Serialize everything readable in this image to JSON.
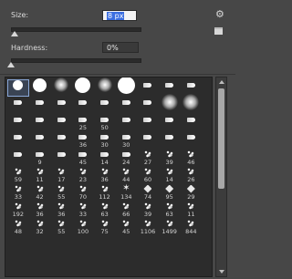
{
  "size": {
    "label": "Size:",
    "value": "8 px",
    "level": 0.03
  },
  "hardness": {
    "label": "Hardness:",
    "value": "0%",
    "level": 0.0
  },
  "icons": {
    "settings": "gear-icon",
    "new_preset": "new-preset-icon"
  },
  "brushes": [
    {
      "kind": "hard",
      "label": ""
    },
    {
      "kind": "hard",
      "label": ""
    },
    {
      "kind": "soft",
      "label": ""
    },
    {
      "kind": "hard",
      "label": ""
    },
    {
      "kind": "soft",
      "label": ""
    },
    {
      "kind": "hard",
      "label": ""
    },
    {
      "kind": "tip",
      "label": ""
    },
    {
      "kind": "tip",
      "label": ""
    },
    {
      "kind": "tip",
      "label": ""
    },
    {
      "kind": "tip",
      "label": ""
    },
    {
      "kind": "tip",
      "label": ""
    },
    {
      "kind": "tip",
      "label": ""
    },
    {
      "kind": "tip",
      "label": ""
    },
    {
      "kind": "tip",
      "label": ""
    },
    {
      "kind": "tip",
      "label": ""
    },
    {
      "kind": "tip",
      "label": ""
    },
    {
      "kind": "soft",
      "label": ""
    },
    {
      "kind": "soft",
      "label": ""
    },
    {
      "kind": "tip",
      "label": ""
    },
    {
      "kind": "tip",
      "label": ""
    },
    {
      "kind": "tip",
      "label": ""
    },
    {
      "kind": "tip",
      "label": "25"
    },
    {
      "kind": "tip",
      "label": "50"
    },
    {
      "kind": "tip",
      "label": ""
    },
    {
      "kind": "tip",
      "label": ""
    },
    {
      "kind": "tip",
      "label": ""
    },
    {
      "kind": "tip",
      "label": ""
    },
    {
      "kind": "tip",
      "label": ""
    },
    {
      "kind": "tip",
      "label": ""
    },
    {
      "kind": "tip",
      "label": ""
    },
    {
      "kind": "tip",
      "label": "36"
    },
    {
      "kind": "tip",
      "label": "30"
    },
    {
      "kind": "tip",
      "label": "30"
    },
    {
      "kind": "tip",
      "label": ""
    },
    {
      "kind": "tip",
      "label": ""
    },
    {
      "kind": "tip",
      "label": ""
    },
    {
      "kind": "tip",
      "label": ""
    },
    {
      "kind": "tip",
      "label": "9"
    },
    {
      "kind": "tip",
      "label": ""
    },
    {
      "kind": "tip",
      "label": "45"
    },
    {
      "kind": "tip",
      "label": "14"
    },
    {
      "kind": "tip",
      "label": "24"
    },
    {
      "kind": "splat",
      "label": "27"
    },
    {
      "kind": "splat",
      "label": "39"
    },
    {
      "kind": "splat",
      "label": "46"
    },
    {
      "kind": "splat",
      "label": "59"
    },
    {
      "kind": "splat",
      "label": "11"
    },
    {
      "kind": "splat",
      "label": "17"
    },
    {
      "kind": "splat",
      "label": "23"
    },
    {
      "kind": "splat",
      "label": "36"
    },
    {
      "kind": "splat",
      "label": "44"
    },
    {
      "kind": "splat",
      "label": "60"
    },
    {
      "kind": "splat",
      "label": "14"
    },
    {
      "kind": "splat",
      "label": "26"
    },
    {
      "kind": "splat",
      "label": "33"
    },
    {
      "kind": "splat",
      "label": "42"
    },
    {
      "kind": "splat",
      "label": "55"
    },
    {
      "kind": "splat",
      "label": "70"
    },
    {
      "kind": "splat",
      "label": "112"
    },
    {
      "kind": "star",
      "label": "134"
    },
    {
      "kind": "leaf",
      "label": "74"
    },
    {
      "kind": "leaf",
      "label": "95"
    },
    {
      "kind": "leaf",
      "label": "29"
    },
    {
      "kind": "splat",
      "label": "192"
    },
    {
      "kind": "splat",
      "label": "36"
    },
    {
      "kind": "splat",
      "label": "36"
    },
    {
      "kind": "splat",
      "label": "33"
    },
    {
      "kind": "splat",
      "label": "63"
    },
    {
      "kind": "splat",
      "label": "66"
    },
    {
      "kind": "splat",
      "label": "39"
    },
    {
      "kind": "splat",
      "label": "63"
    },
    {
      "kind": "splat",
      "label": "11"
    },
    {
      "kind": "splat",
      "label": "48"
    },
    {
      "kind": "splat",
      "label": "32"
    },
    {
      "kind": "splat",
      "label": "55"
    },
    {
      "kind": "splat",
      "label": "100"
    },
    {
      "kind": "splat",
      "label": "75"
    },
    {
      "kind": "splat",
      "label": "45"
    },
    {
      "kind": "splat",
      "label": "1106"
    },
    {
      "kind": "splat",
      "label": "1499"
    },
    {
      "kind": "splat",
      "label": "844"
    }
  ]
}
